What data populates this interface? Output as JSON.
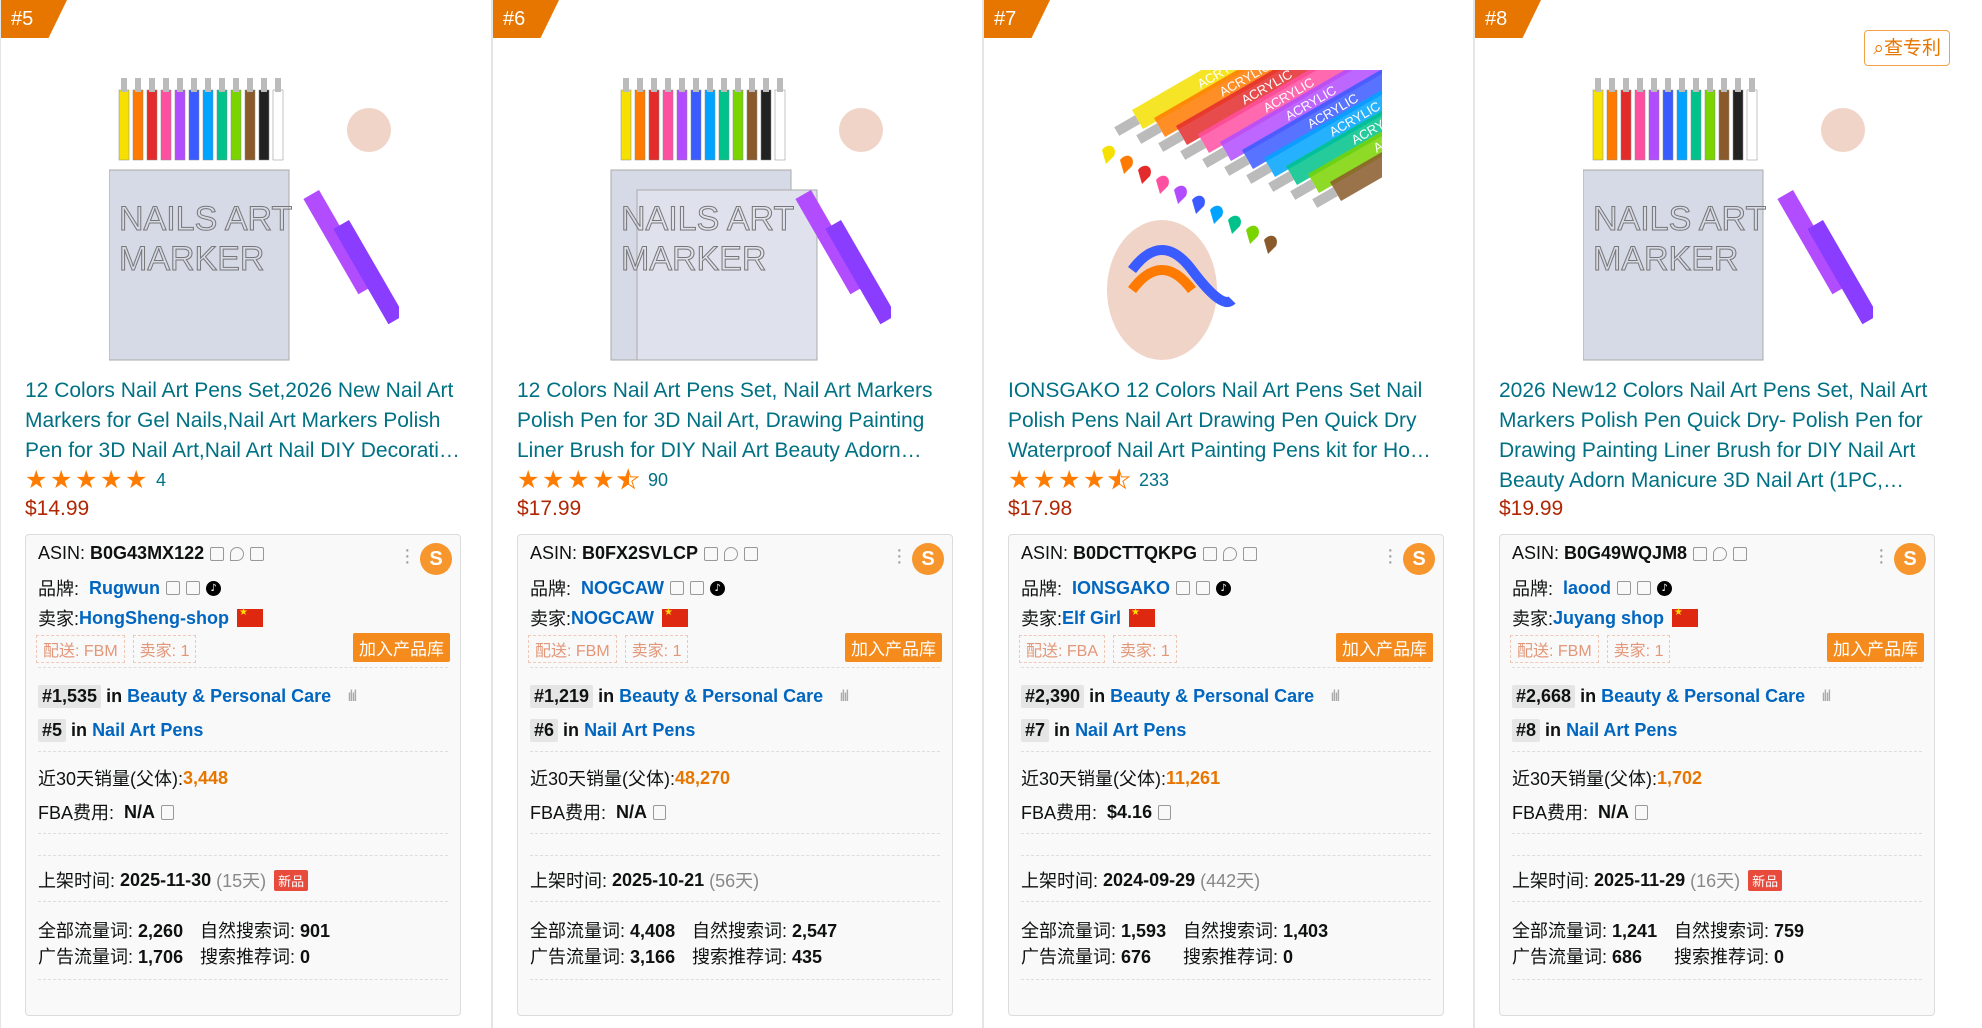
{
  "products": [
    {
      "rank": "#5",
      "title": "12 Colors Nail Art Pens Set,2026 New Nail Art Markers for Gel Nails,Nail Art Markers Polish Pen for 3D Nail Art,Nail Art Nail DIY Decorati…",
      "rating_count": "4",
      "price": "$14.99",
      "asin_label": "ASIN:",
      "asin": "B0G43MX122",
      "brand_label": "品牌:",
      "brand": "Rugwun",
      "seller_label": "卖家:",
      "seller": "HongSheng-shop",
      "delivery": "配送: FBM",
      "sellers": "卖家: 1",
      "add_label": "加入产品库",
      "bsr_main": "#1,535",
      "bsr_main_cat": "Beauty & Personal Care",
      "bsr_sub": "#5",
      "bsr_sub_cat": "Nail Art Pens",
      "sales_label": "近30天销量(父体):",
      "sales": "3,448",
      "fba_label": "FBA费用:",
      "fba": "N/A",
      "listed_label": "上架时间:",
      "listed": "2025-11-30",
      "days": "(15天)",
      "new_badge": "新品",
      "total_kw_label": "全部流量词:",
      "total_kw": "2,260",
      "organic_label": "自然搜索词:",
      "organic": "901",
      "ad_kw_label": "广告流量词:",
      "ad_kw": "1,706",
      "rec_label": "搜索推荐词:",
      "rec": "0",
      "stars": 5
    },
    {
      "rank": "#6",
      "title": "12 Colors Nail Art Pens Set, Nail Art Markers Polish Pen for 3D Nail Art, Drawing Painting Liner Brush for DIY Nail Art Beauty Adorn…",
      "rating_count": "90",
      "price": "$17.99",
      "asin_label": "ASIN:",
      "asin": "B0FX2SVLCP",
      "brand_label": "品牌:",
      "brand": "NOGCAW",
      "seller_label": "卖家:",
      "seller": "NOGCAW",
      "delivery": "配送: FBM",
      "sellers": "卖家: 1",
      "add_label": "加入产品库",
      "bsr_main": "#1,219",
      "bsr_main_cat": "Beauty & Personal Care",
      "bsr_sub": "#6",
      "bsr_sub_cat": "Nail Art Pens",
      "sales_label": "近30天销量(父体):",
      "sales": "48,270",
      "fba_label": "FBA费用:",
      "fba": "N/A",
      "listed_label": "上架时间:",
      "listed": "2025-10-21",
      "days": "(56天)",
      "new_badge": "",
      "total_kw_label": "全部流量词:",
      "total_kw": "4,408",
      "organic_label": "自然搜索词:",
      "organic": "2,547",
      "ad_kw_label": "广告流量词:",
      "ad_kw": "3,166",
      "rec_label": "搜索推荐词:",
      "rec": "435",
      "stars": 4.5
    },
    {
      "rank": "#7",
      "title": "IONSGAKO 12 Colors Nail Art Pens Set Nail Polish Pens Nail Art Drawing Pen Quick Dry Waterproof Nail Art Painting Pens kit for Ho…",
      "rating_count": "233",
      "price": "$17.98",
      "asin_label": "ASIN:",
      "asin": "B0DCTTQKPG",
      "brand_label": "品牌:",
      "brand": "IONSGAKO",
      "seller_label": "卖家:",
      "seller": "Elf Girl",
      "delivery": "配送: FBA",
      "sellers": "卖家: 1",
      "add_label": "加入产品库",
      "bsr_main": "#2,390",
      "bsr_main_cat": "Beauty & Personal Care",
      "bsr_sub": "#7",
      "bsr_sub_cat": "Nail Art Pens",
      "sales_label": "近30天销量(父体):",
      "sales": "11,261",
      "fba_label": "FBA费用:",
      "fba": "$4.16",
      "listed_label": "上架时间:",
      "listed": "2024-09-29",
      "days": "(442天)",
      "new_badge": "",
      "total_kw_label": "全部流量词:",
      "total_kw": "1,593",
      "organic_label": "自然搜索词:",
      "organic": "1,403",
      "ad_kw_label": "广告流量词:",
      "ad_kw": "676",
      "rec_label": "搜索推荐词:",
      "rec": "0",
      "stars": 4.5
    },
    {
      "rank": "#8",
      "title": "2026 New12 Colors Nail Art Pens Set, Nail Art Markers Polish Pen Quick Dry- Polish Pen for Drawing Painting Liner Brush for DIY Nail Art Beauty Adorn Manicure 3D Nail Art (1PC,…",
      "rating_count": "",
      "price": "$19.99",
      "asin_label": "ASIN:",
      "asin": "B0G49WQJM8",
      "brand_label": "品牌:",
      "brand": "laood",
      "seller_label": "卖家:",
      "seller": "Juyang shop",
      "delivery": "配送: FBM",
      "sellers": "卖家: 1",
      "add_label": "加入产品库",
      "bsr_main": "#2,668",
      "bsr_main_cat": "Beauty & Personal Care",
      "bsr_sub": "#8",
      "bsr_sub_cat": "Nail Art Pens",
      "sales_label": "近30天销量(父体):",
      "sales": "1,702",
      "fba_label": "FBA费用:",
      "fba": "N/A",
      "listed_label": "上架时间:",
      "listed": "2025-11-29",
      "days": "(16天)",
      "new_badge": "新品",
      "total_kw_label": "全部流量词:",
      "total_kw": "1,241",
      "organic_label": "自然搜索词:",
      "organic": "759",
      "ad_kw_label": "广告流量词:",
      "ad_kw": "686",
      "rec_label": "搜索推荐词:",
      "rec": "0",
      "stars": 0
    }
  ],
  "patent_label": "查专利",
  "in_word": "in",
  "accent": "#e77600",
  "link_color": "#007185",
  "price_color": "#b12704"
}
